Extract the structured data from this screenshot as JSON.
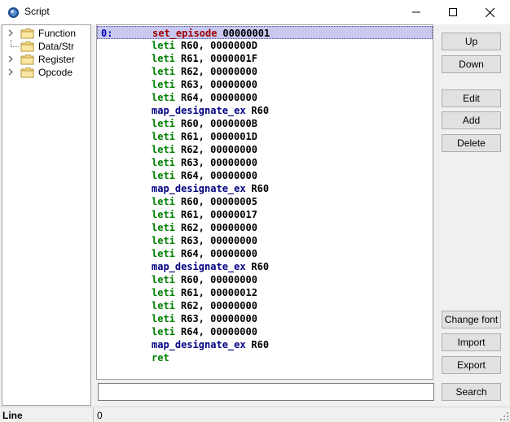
{
  "window": {
    "title": "Script"
  },
  "tree": {
    "items": [
      {
        "label": "Function",
        "expandable": true
      },
      {
        "label": "Data/Str",
        "expandable": false
      },
      {
        "label": "Register",
        "expandable": true
      },
      {
        "label": "Opcode",
        "expandable": true
      }
    ]
  },
  "code": {
    "lines": [
      {
        "index": "0:",
        "op": "set_episode",
        "arg": "00000001",
        "kind": "special",
        "selected": true
      },
      {
        "index": "",
        "op": "leti",
        "arg": "R60, 0000000D",
        "kind": "leti"
      },
      {
        "index": "",
        "op": "leti",
        "arg": "R61, 0000001F",
        "kind": "leti"
      },
      {
        "index": "",
        "op": "leti",
        "arg": "R62, 00000000",
        "kind": "leti"
      },
      {
        "index": "",
        "op": "leti",
        "arg": "R63, 00000000",
        "kind": "leti"
      },
      {
        "index": "",
        "op": "leti",
        "arg": "R64, 00000000",
        "kind": "leti"
      },
      {
        "index": "",
        "op": "map_designate_ex",
        "arg": "R60",
        "kind": "call"
      },
      {
        "index": "",
        "op": "leti",
        "arg": "R60, 0000000B",
        "kind": "leti"
      },
      {
        "index": "",
        "op": "leti",
        "arg": "R61, 0000001D",
        "kind": "leti"
      },
      {
        "index": "",
        "op": "leti",
        "arg": "R62, 00000000",
        "kind": "leti"
      },
      {
        "index": "",
        "op": "leti",
        "arg": "R63, 00000000",
        "kind": "leti"
      },
      {
        "index": "",
        "op": "leti",
        "arg": "R64, 00000000",
        "kind": "leti"
      },
      {
        "index": "",
        "op": "map_designate_ex",
        "arg": "R60",
        "kind": "call"
      },
      {
        "index": "",
        "op": "leti",
        "arg": "R60, 00000005",
        "kind": "leti"
      },
      {
        "index": "",
        "op": "leti",
        "arg": "R61, 00000017",
        "kind": "leti"
      },
      {
        "index": "",
        "op": "leti",
        "arg": "R62, 00000000",
        "kind": "leti"
      },
      {
        "index": "",
        "op": "leti",
        "arg": "R63, 00000000",
        "kind": "leti"
      },
      {
        "index": "",
        "op": "leti",
        "arg": "R64, 00000000",
        "kind": "leti"
      },
      {
        "index": "",
        "op": "map_designate_ex",
        "arg": "R60",
        "kind": "call"
      },
      {
        "index": "",
        "op": "leti",
        "arg": "R60, 00000000",
        "kind": "leti"
      },
      {
        "index": "",
        "op": "leti",
        "arg": "R61, 00000012",
        "kind": "leti"
      },
      {
        "index": "",
        "op": "leti",
        "arg": "R62, 00000000",
        "kind": "leti"
      },
      {
        "index": "",
        "op": "leti",
        "arg": "R63, 00000000",
        "kind": "leti"
      },
      {
        "index": "",
        "op": "leti",
        "arg": "R64, 00000000",
        "kind": "leti"
      },
      {
        "index": "",
        "op": "map_designate_ex",
        "arg": "R60",
        "kind": "call"
      },
      {
        "index": "",
        "op": "ret",
        "arg": "",
        "kind": "leti"
      }
    ]
  },
  "colors": {
    "special_op": "#a00000",
    "special_arg": "#000000",
    "leti_op": "#008000",
    "leti_arg": "#000000",
    "call_op": "#000080",
    "call_arg": "#000000"
  },
  "buttons": {
    "up": "Up",
    "down": "Down",
    "edit": "Edit",
    "add": "Add",
    "delete": "Delete",
    "change_font": "Change font",
    "import": "Import",
    "export": "Export",
    "search": "Search"
  },
  "search": {
    "value": ""
  },
  "status": {
    "label": "Line",
    "value": "0"
  }
}
